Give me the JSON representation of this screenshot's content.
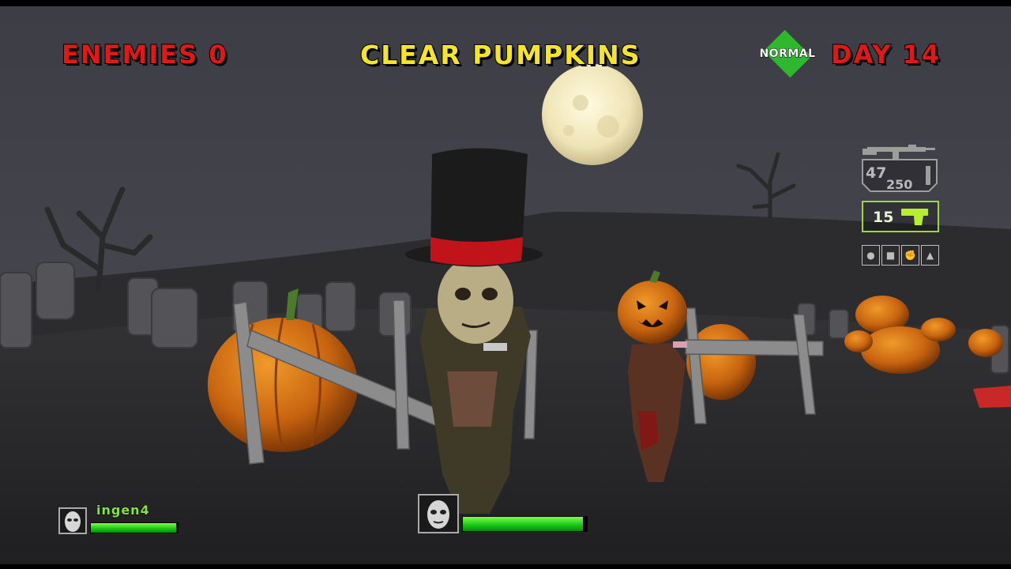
{
  "hud": {
    "enemies_label": "ENEMIES 0",
    "objective": "CLEAR PUMPKINS",
    "difficulty": "NORMAL",
    "day_label": "DAY 14"
  },
  "weapons": {
    "primary": {
      "icon": "assault-rifle-icon",
      "clip": "47",
      "reserve": "250"
    },
    "secondary": {
      "icon": "pistol-icon",
      "ammo": "15",
      "accent": "#9ad93a"
    },
    "item_slots": [
      "grenade-icon",
      "item-icon",
      "fist-icon",
      "boot-icon"
    ]
  },
  "players": {
    "player1": {
      "health": 0.97
    },
    "player2": {
      "name": "ingen4",
      "health": 0.98
    }
  },
  "colors": {
    "enemies": "#e01818",
    "objective": "#f4e52a",
    "difficulty": "#2fb82f",
    "health": "#15c515"
  }
}
